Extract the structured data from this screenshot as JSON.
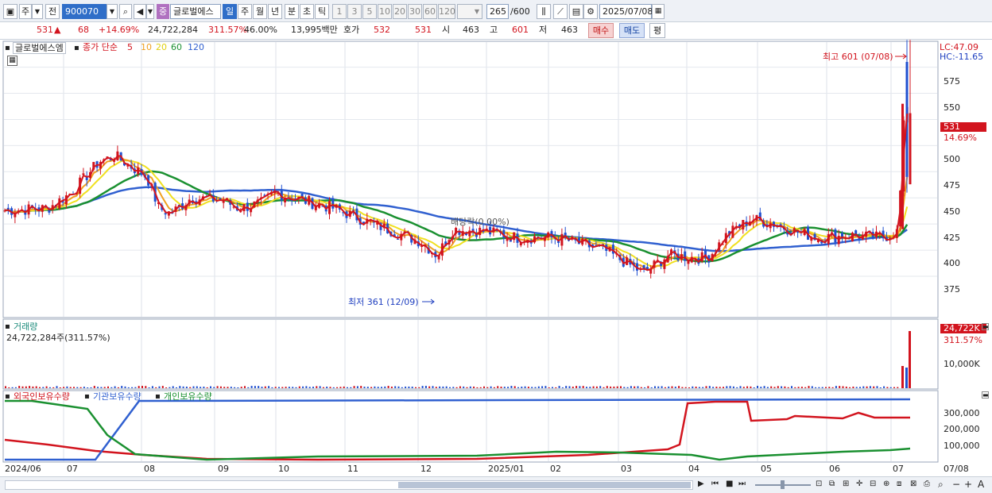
{
  "toolbar": {
    "mode_label": "주",
    "prev_label": "전",
    "code_value": "900070",
    "tag_label": "중",
    "stock_name": "글로벌에스",
    "period_tabs": [
      "일",
      "주",
      "월",
      "년",
      "분",
      "초",
      "틱"
    ],
    "active_period": "일",
    "minute_tabs": [
      "1",
      "3",
      "5",
      "10",
      "20",
      "30",
      "60",
      "120"
    ],
    "count_value": "265",
    "count_total": "/600",
    "date_value": "2025/07/08"
  },
  "quote": {
    "price": "531",
    "arrow": "▲",
    "change": "68",
    "change_pct": "+14.69%",
    "volume": "24,722,284",
    "vol_ratio": "311.57%",
    "turnover": "46.00%",
    "amount": "13,995백만",
    "hoga_label": "호가",
    "ask": "532",
    "bid": "531",
    "open_label": "시",
    "open": "463",
    "high_label": "고",
    "high": "601",
    "low_label": "저",
    "low": "463",
    "buy_label": "매수",
    "sell_label": "매도",
    "flat_label": "평"
  },
  "price_panel": {
    "stock_label": "글로벌에스엠",
    "ma_label": "종가 단순",
    "ma_periods": [
      "5",
      "10",
      "20",
      "60",
      "120"
    ],
    "ma_colors": [
      "#d2141e",
      "#f0a020",
      "#f0e020",
      "#1a9030",
      "#3060d0"
    ],
    "lc_label": "LC:47.09",
    "hc_label": "HC:-11.65",
    "high_annotation": "최고 601 (07/08)",
    "low_annotation": "최저 361 (12/09)",
    "dividend_label": "배당락(0.00%)",
    "current_price_tag": "531",
    "current_pct_tag": "14.69%",
    "y_ticks": [
      "575",
      "550",
      "525",
      "500",
      "475",
      "450",
      "425",
      "400",
      "375"
    ]
  },
  "volume_panel": {
    "title": "거래량",
    "value_text": "24,722,284주(311.57%)",
    "tag_value": "24,722K",
    "tag_pct": "311.57%",
    "y_tick": "10,000K"
  },
  "holding_panel": {
    "legend": [
      "외국인보유수량",
      "기관보유수량",
      "개인보유수량"
    ],
    "legend_colors": [
      "#d2141e",
      "#3060d0",
      "#1a9030"
    ],
    "y_ticks": [
      "300,000",
      "200,000",
      "100,000"
    ]
  },
  "x_axis": [
    "2024/06",
    "07",
    "08",
    "09",
    "10",
    "11",
    "12",
    "2025/01",
    "02",
    "03",
    "04",
    "05",
    "06",
    "07",
    "07/08"
  ],
  "chart_data": {
    "type": "candlestick",
    "period": "daily",
    "y_range": [
      350,
      605
    ],
    "summary": {
      "high": 601,
      "high_date": "07/08",
      "low": 361,
      "low_date": "12/09",
      "last": 531,
      "change_pct": 14.69
    }
  }
}
